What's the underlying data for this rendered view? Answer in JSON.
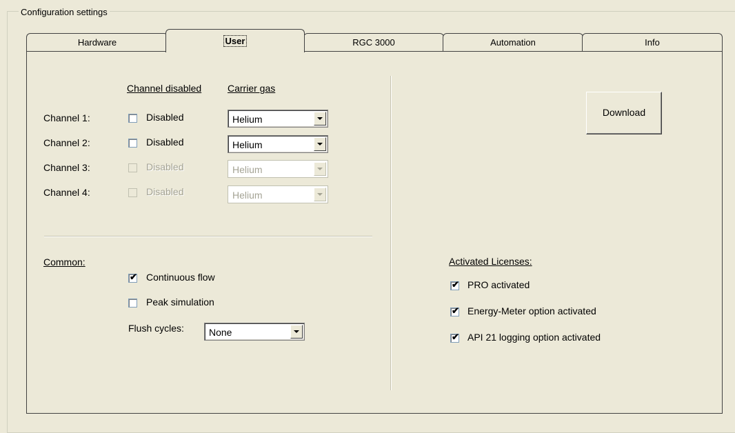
{
  "group_title": "Configuration settings",
  "tabs": [
    {
      "label": "Hardware"
    },
    {
      "label": "User"
    },
    {
      "label": "RGC 3000"
    },
    {
      "label": "Automation"
    },
    {
      "label": "Info"
    }
  ],
  "active_tab": "User",
  "channels": {
    "header_disabled": "Channel disabled",
    "header_gas": "Carrier gas",
    "rows": [
      {
        "label": "Channel 1:",
        "checkbox_label": "Disabled",
        "checked": false,
        "enabled": true,
        "gas": "Helium"
      },
      {
        "label": "Channel 2:",
        "checkbox_label": "Disabled",
        "checked": false,
        "enabled": true,
        "gas": "Helium"
      },
      {
        "label": "Channel 3:",
        "checkbox_label": "Disabled",
        "checked": false,
        "enabled": false,
        "gas": "Helium"
      },
      {
        "label": "Channel 4:",
        "checkbox_label": "Disabled",
        "checked": false,
        "enabled": false,
        "gas": "Helium"
      }
    ]
  },
  "download_label": "Download",
  "common": {
    "title": "Common:",
    "continuous_flow": {
      "label": "Continuous flow",
      "checked": true
    },
    "peak_simulation": {
      "label": "Peak simulation",
      "checked": false
    },
    "flush_label": "Flush cycles:",
    "flush_value": "None"
  },
  "licenses": {
    "title": "Activated Licenses:",
    "items": [
      {
        "label": "PRO activated",
        "checked": true
      },
      {
        "label": "Energy-Meter option activated",
        "checked": true
      },
      {
        "label": "API 21 logging option activated",
        "checked": true
      }
    ]
  }
}
